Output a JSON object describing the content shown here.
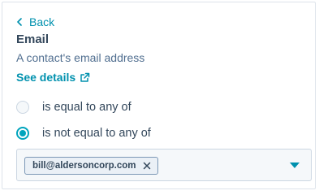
{
  "filter_panel": {
    "back_label": "Back",
    "property_name": "Email",
    "property_description": "A contact's email address",
    "see_details_label": "See details",
    "operators": [
      {
        "label": "is equal to any of",
        "selected": false
      },
      {
        "label": "is not equal to any of",
        "selected": true
      }
    ],
    "value_select": {
      "tags": [
        "bill@aldersoncorp.com"
      ]
    }
  },
  "icons": {
    "back": "chevron-left-icon",
    "external": "external-link-icon",
    "tag_remove": "close-icon",
    "dropdown": "caret-down-icon"
  },
  "colors": {
    "link": "#0091ae",
    "radio_active": "#00a4bd",
    "text_primary": "#33475b",
    "text_secondary": "#516f90",
    "border": "#cbd6e2",
    "input_bg": "#f5f8fa",
    "tag_bg": "#eaf0f6",
    "tag_border": "#7c98b6"
  }
}
